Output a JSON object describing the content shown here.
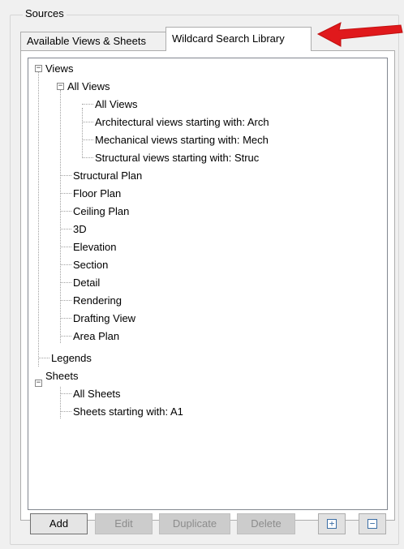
{
  "group": {
    "title": "Sources"
  },
  "tabs": [
    {
      "label": "Available Views & Sheets",
      "active": false
    },
    {
      "label": "Wildcard Search Library",
      "active": true
    }
  ],
  "tree": {
    "nodes": [
      {
        "label": "Views",
        "toggle": "⊟"
      },
      {
        "label": "All Views",
        "toggle": "⊟"
      },
      {
        "label": "All Views"
      },
      {
        "label": "Architectural views starting with: Arch"
      },
      {
        "label": "Mechanical views starting with: Mech"
      },
      {
        "label": "Structural views starting with: Struc"
      },
      {
        "label": "Structural Plan"
      },
      {
        "label": "Floor Plan"
      },
      {
        "label": "Ceiling Plan"
      },
      {
        "label": "3D"
      },
      {
        "label": "Elevation"
      },
      {
        "label": "Section"
      },
      {
        "label": "Detail"
      },
      {
        "label": "Rendering"
      },
      {
        "label": "Drafting View"
      },
      {
        "label": "Area Plan"
      },
      {
        "label": "Legends"
      },
      {
        "label": "Sheets",
        "toggle": "⊟"
      },
      {
        "label": "All Sheets"
      },
      {
        "label": "Sheets starting with: A1"
      }
    ]
  },
  "buttons": {
    "add": "Add",
    "edit": "Edit",
    "duplicate": "Duplicate",
    "delete": "Delete",
    "expand_icon": "⊞",
    "collapse_icon": "⊟"
  },
  "colors": {
    "arrow": "#e0191c",
    "panel_bg": "#f0f0f0"
  }
}
